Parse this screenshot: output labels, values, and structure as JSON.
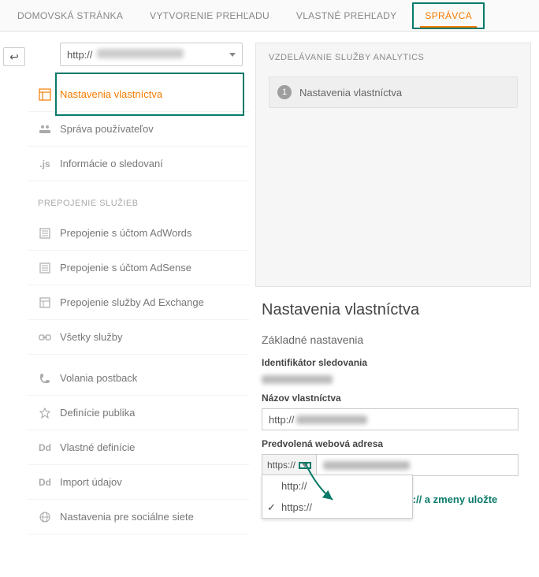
{
  "topnav": {
    "tabs": [
      {
        "label": "DOMOVSKÁ STRÁNKA"
      },
      {
        "label": "VYTVORENIE PREHĽADU"
      },
      {
        "label": "VLASTNÉ PREHĽADY"
      },
      {
        "label": "SPRÁVCA"
      }
    ]
  },
  "back_icon": "↩",
  "property_select": {
    "prefix": "http://"
  },
  "sidebar": {
    "items": [
      {
        "label": "Nastavenia vlastníctva"
      },
      {
        "label": "Správa používateľov"
      },
      {
        "label": "Informácie o sledovaní"
      }
    ],
    "group_header": "PREPOJENIE SLUŽIEB",
    "group": [
      {
        "label": "Prepojenie s účtom AdWords"
      },
      {
        "label": "Prepojenie s účtom AdSense"
      },
      {
        "label": "Prepojenie služby Ad Exchange"
      },
      {
        "label": "Všetky služby"
      }
    ],
    "rest": [
      {
        "label": "Volania postback"
      },
      {
        "label": "Definície publika"
      },
      {
        "label": "Vlastné definície"
      },
      {
        "label": "Import údajov"
      },
      {
        "label": "Nastavenia pre sociálne siete"
      }
    ],
    "icons": {
      "js_label": ".js",
      "dd_label": "Dd"
    }
  },
  "wizard": {
    "header": "VZDELÁVANIE SLUŽBY ANALYTICS",
    "step1_num": "1",
    "step1_label": "Nastavenia vlastníctva"
  },
  "settings": {
    "title": "Nastavenia vlastníctva",
    "basic_header": "Základné nastavenia",
    "tracking_id_label": "Identifikátor sledovania",
    "name_label": "Názov vlastníctva",
    "name_prefix": "http://",
    "url_label": "Predvolená webová adresa",
    "proto_selected": "https://",
    "options": {
      "http": "http://",
      "https": "https://"
    },
    "hint": "vyberte https:// a zmeny uložte"
  }
}
